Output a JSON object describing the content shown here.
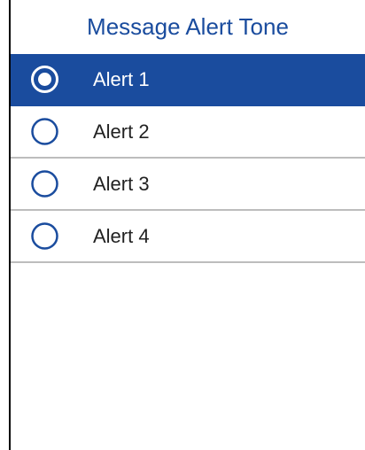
{
  "header": {
    "title": "Message Alert Tone"
  },
  "options": [
    {
      "label": "Alert 1",
      "selected": true
    },
    {
      "label": "Alert 2",
      "selected": false
    },
    {
      "label": "Alert 3",
      "selected": false
    },
    {
      "label": "Alert 4",
      "selected": false
    }
  ],
  "colors": {
    "accent": "#1a4c9e",
    "selected_text": "#ffffff",
    "text": "#222222",
    "divider": "#bdbdbd"
  }
}
